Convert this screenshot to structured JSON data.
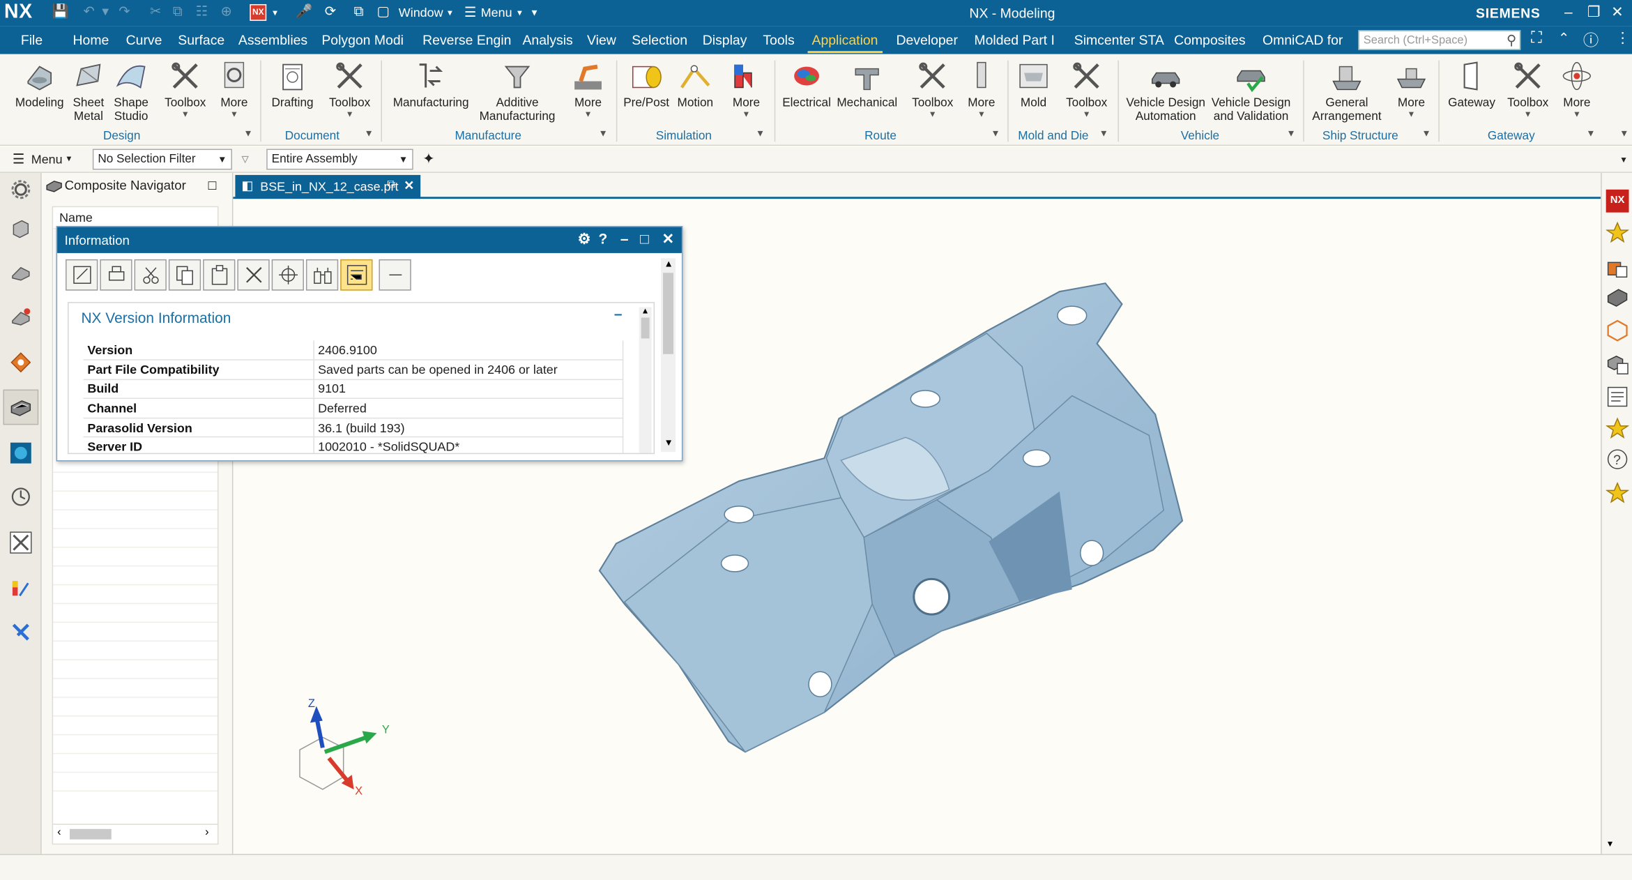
{
  "app": {
    "logo": "NX",
    "window_title": "NX - Modeling",
    "brand": "SIEMENS",
    "qa_window_label": "Window",
    "qa_menu_label": "Menu"
  },
  "menubar": {
    "items": [
      "File",
      "Home",
      "Curve",
      "Surface",
      "Assemblies",
      "Polygon Modi",
      "Reverse Engin",
      "Analysis",
      "View",
      "Selection",
      "Display",
      "Tools",
      "Application",
      "Developer",
      "Molded Part I",
      "Simcenter STA",
      "Composites",
      "OmniCAD for"
    ],
    "active": "Application",
    "search_placeholder": "Search (Ctrl+Space)"
  },
  "ribbon": {
    "groups": [
      {
        "name": "Design",
        "buttons": [
          "Modeling",
          "Sheet Metal",
          "Shape Studio",
          "Toolbox",
          "More"
        ]
      },
      {
        "name": "Document",
        "buttons": [
          "Drafting",
          "Toolbox"
        ]
      },
      {
        "name": "Manufacture",
        "buttons": [
          "Manufacturing",
          "Additive Manufacturing",
          "More"
        ]
      },
      {
        "name": "Simulation",
        "buttons": [
          "Pre/Post",
          "Motion",
          "More"
        ]
      },
      {
        "name": "Route",
        "buttons": [
          "Electrical",
          "Mechanical",
          "Toolbox",
          "More"
        ]
      },
      {
        "name": "Mold and Die",
        "buttons": [
          "Mold",
          "Toolbox"
        ]
      },
      {
        "name": "Vehicle",
        "buttons": [
          "Vehicle Design Automation",
          "Vehicle Design and Validation"
        ]
      },
      {
        "name": "Ship Structure",
        "buttons": [
          "General Arrangement",
          "More"
        ]
      },
      {
        "name": "Gateway",
        "buttons": [
          "Gateway",
          "Toolbox",
          "More"
        ]
      }
    ]
  },
  "selection_bar": {
    "menu_label": "Menu",
    "filter_value": "No Selection Filter",
    "scope_value": "Entire Assembly"
  },
  "navigator": {
    "title": "Composite Navigator",
    "column_name": "Name"
  },
  "tabs": [
    {
      "label": "BSE_in_NX_12_case.prt"
    }
  ],
  "info_dialog": {
    "title": "Information",
    "section_title": "NX Version Information",
    "rows": [
      {
        "key": "Version",
        "value": "2406.9100"
      },
      {
        "key": "Part File Compatibility",
        "value": "Saved parts can be opened in 2406 or later"
      },
      {
        "key": "Build",
        "value": "9101"
      },
      {
        "key": "Channel",
        "value": "Deferred"
      },
      {
        "key": "Parasolid Version",
        "value": "36.1 (build 193)"
      },
      {
        "key": "Server ID",
        "value": "1002010 - *SolidSQUAD*"
      }
    ]
  },
  "triad": {
    "x": "X",
    "y": "Y",
    "z": "Z"
  },
  "colors": {
    "titlebar": "#0c6294",
    "accent": "#ffd24a",
    "part": "#9bbbd3"
  }
}
